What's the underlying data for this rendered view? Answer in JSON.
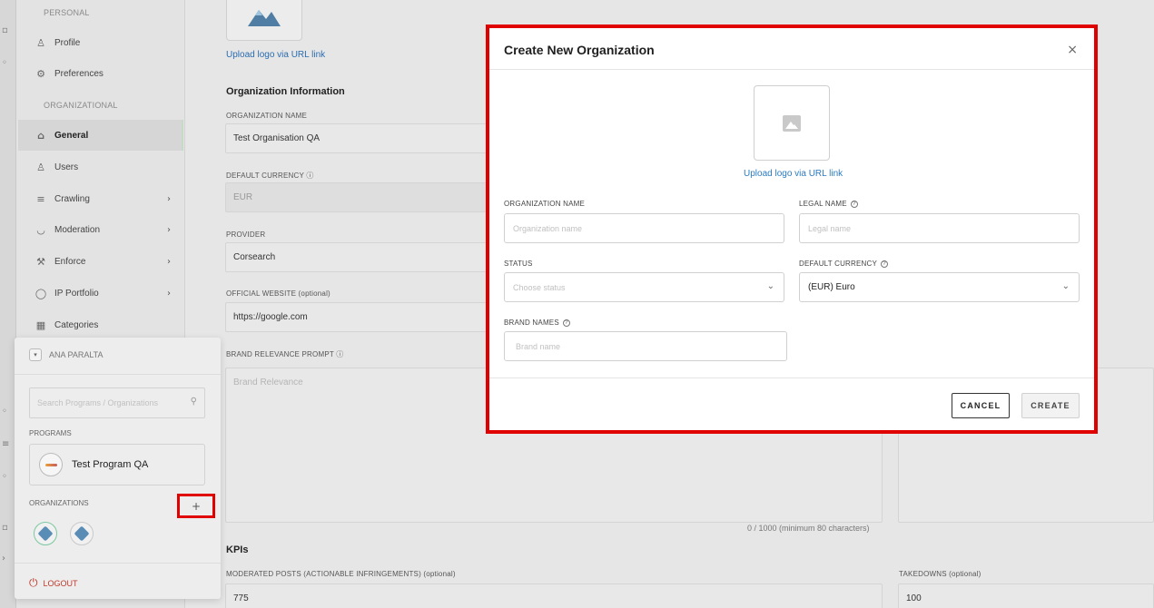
{
  "sidebar": {
    "personal_label": "PERSONAL",
    "organizational_label": "ORGANIZATIONAL",
    "items": [
      {
        "label": "Profile",
        "icon": "user-icon"
      },
      {
        "label": "Preferences",
        "icon": "gear-icon"
      },
      {
        "label": "General",
        "icon": "home-icon"
      },
      {
        "label": "Users",
        "icon": "users-icon"
      },
      {
        "label": "Crawling",
        "icon": "crawling-icon"
      },
      {
        "label": "Moderation",
        "icon": "shield-check-icon"
      },
      {
        "label": "Enforce",
        "icon": "gavel-icon"
      },
      {
        "label": "IP Portfolio",
        "icon": "shield-icon"
      },
      {
        "label": "Categories",
        "icon": "grid-icon"
      }
    ]
  },
  "background_form": {
    "upload_link": "Upload logo via URL link",
    "section_title": "Organization Information",
    "org_name_label": "ORGANIZATION NAME",
    "org_name_value": "Test Organisation QA",
    "default_currency_label": "DEFAULT CURRENCY",
    "default_currency_value": "EUR",
    "provider_label": "PROVIDER",
    "provider_value": "Corsearch",
    "website_label": "OFFICIAL WEBSITE (optional)",
    "website_value": "https://google.com",
    "brand_prompt_label": "BRAND RELEVANCE PROMPT",
    "brand_prompt_placeholder": "Brand Relevance",
    "char_count": "0 / 1000 (minimum 80 characters)",
    "kpis_title": "KPIs",
    "moderated_label": "MODERATED POSTS (ACTIONABLE INFRINGEMENTS) (optional)",
    "moderated_value": "775",
    "takedowns_label": "TAKEDOWNS (optional)",
    "takedowns_value": "100"
  },
  "popup": {
    "user_name": "ANA PARALTA",
    "search_placeholder": "Search Programs / Organizations",
    "programs_label": "PROGRAMS",
    "program_name": "Test Program QA",
    "organizations_label": "ORGANIZATIONS",
    "add_symbol": "+",
    "logout_label": "LOGOUT"
  },
  "modal": {
    "title": "Create New Organization",
    "close_symbol": "×",
    "upload_link": "Upload logo via URL link",
    "org_name_label": "ORGANIZATION NAME",
    "org_name_placeholder": "Organization name",
    "legal_name_label": "LEGAL NAME",
    "legal_name_placeholder": "Legal name",
    "status_label": "STATUS",
    "status_placeholder": "Choose status",
    "currency_label": "DEFAULT CURRENCY",
    "currency_value": "(EUR) Euro",
    "brand_names_label": "BRAND NAMES",
    "brand_names_placeholder": "Brand name",
    "cancel_label": "CANCEL",
    "create_label": "CREATE"
  },
  "colors": {
    "highlight": "#e00000",
    "link": "#2b7bc0",
    "logout": "#c0392b"
  }
}
